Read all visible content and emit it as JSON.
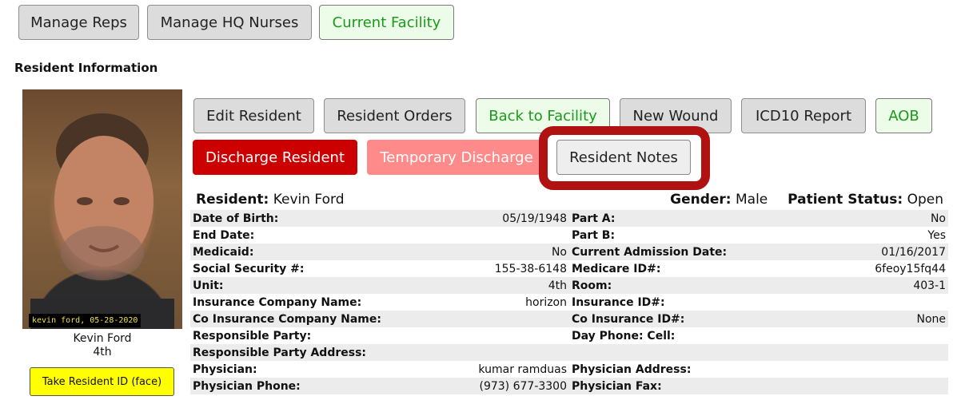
{
  "top_nav": {
    "manage_reps": "Manage Reps",
    "manage_hq_nurses": "Manage HQ Nurses",
    "current_facility": "Current Facility"
  },
  "section_title": "Resident Information",
  "photo": {
    "caption": "kevin ford, 05-28-2020"
  },
  "resident_card": {
    "name": "Kevin Ford",
    "unit": "4th",
    "take_id_label": "Take Resident ID (face)"
  },
  "actions": {
    "edit_resident": "Edit Resident",
    "resident_orders": "Resident Orders",
    "back_to_facility": "Back to Facility",
    "new_wound": "New Wound",
    "icd10_report": "ICD10 Report",
    "aob": "AOB",
    "discharge_resident": "Discharge Resident",
    "temporary_discharge": "Temporary Discharge",
    "resident_notes": "Resident Notes"
  },
  "header": {
    "resident_label": "Resident:",
    "resident_value": "Kevin Ford",
    "gender_label": "Gender:",
    "gender_value": "Male",
    "status_label": "Patient Status:",
    "status_value": "Open"
  },
  "rows": [
    {
      "l1": "Date of Birth:",
      "v1": "05/19/1948",
      "l2": "Part A:",
      "v2": "No"
    },
    {
      "l1": "End Date:",
      "v1": "",
      "l2": "Part B:",
      "v2": "Yes"
    },
    {
      "l1": "Medicaid:",
      "v1": "No",
      "l2": "Current Admission Date:",
      "v2": "01/16/2017"
    },
    {
      "l1": "Social Security #:",
      "v1": "155-38-6148",
      "l2": "Medicare ID#:",
      "v2": "6feoy15fq44"
    },
    {
      "l1": "Unit:",
      "v1": "4th",
      "l2": "Room:",
      "v2": "403-1"
    },
    {
      "l1": "Insurance Company Name:",
      "v1": "horizon",
      "l2": "Insurance ID#:",
      "v2": ""
    },
    {
      "l1": "Co Insurance Company Name:",
      "v1": "",
      "l2": "Co Insurance ID#:",
      "v2": "None"
    },
    {
      "l1": "Responsible Party:",
      "v1": "",
      "l2": "Day Phone: Cell:",
      "v2": ""
    },
    {
      "l1": "Responsible Party Address:",
      "v1": "",
      "l2": "",
      "v2": ""
    },
    {
      "l1": "Physician:",
      "v1": "kumar ramduas",
      "l2": "Physician Address:",
      "v2": ""
    },
    {
      "l1": "Physician Phone:",
      "v1": "(973) 677-3300",
      "l2": "Physician Fax:",
      "v2": ""
    }
  ],
  "colors": {
    "danger": "#cc0000",
    "danger_light": "#ff8a8a",
    "success_text": "#1a9a1a",
    "highlight": "#b01212",
    "id_button": "#ffff00"
  }
}
